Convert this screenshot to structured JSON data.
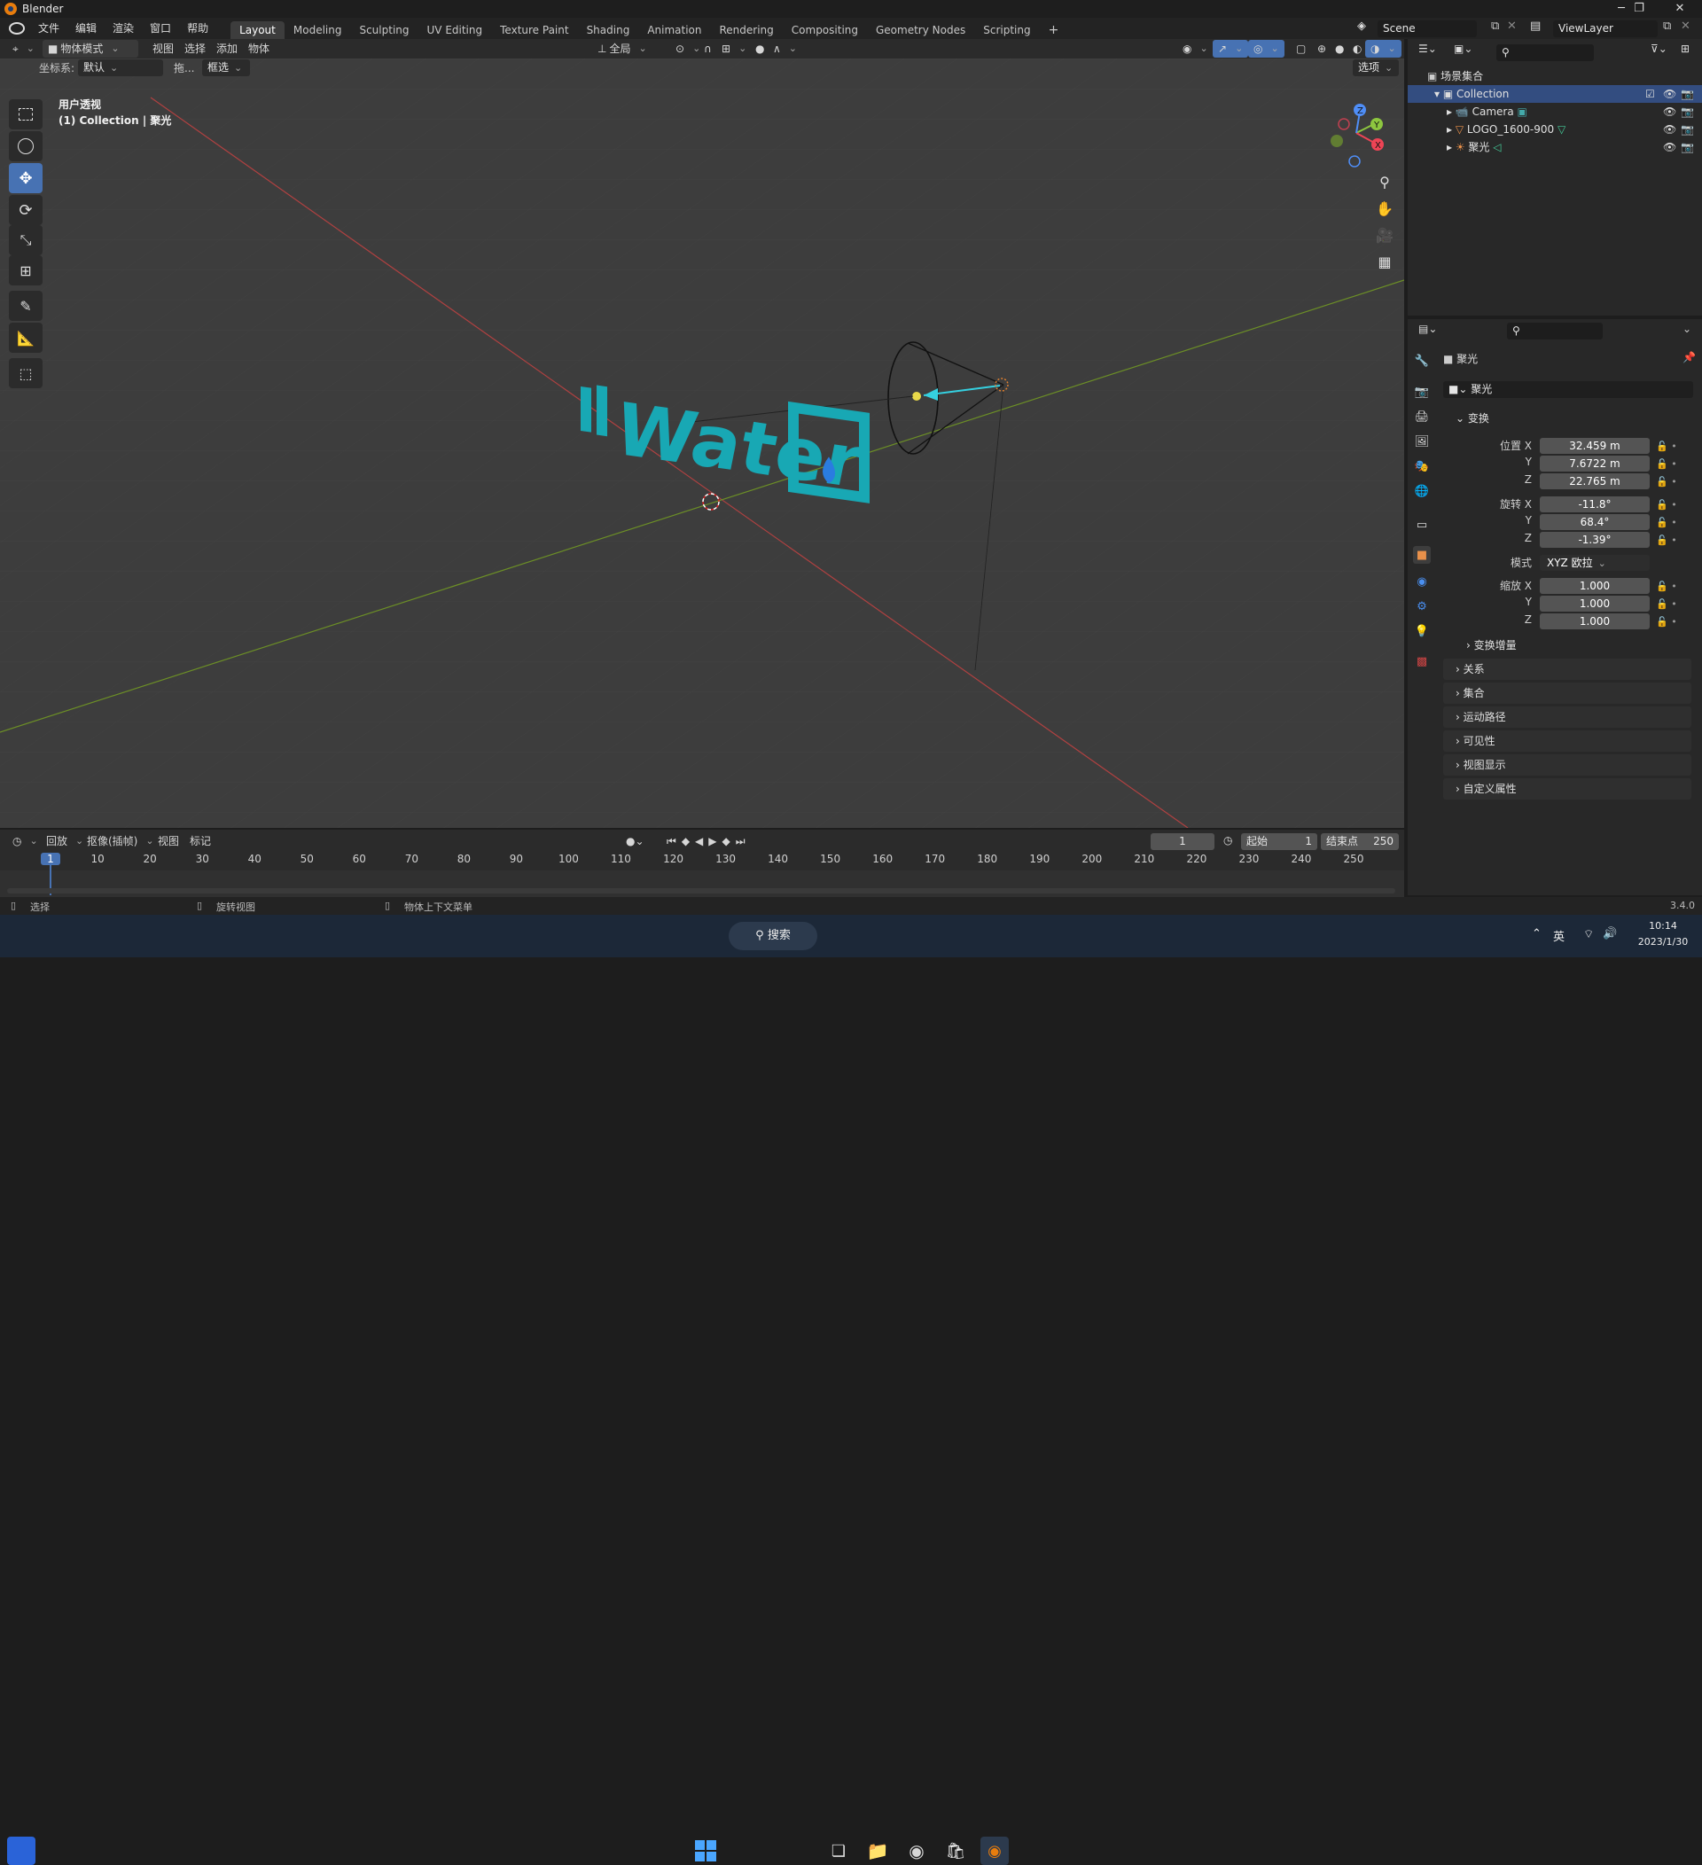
{
  "window": {
    "title": "Blender",
    "min": "─",
    "max": "❐",
    "close": "✕"
  },
  "menu": [
    "文件",
    "编辑",
    "渲染",
    "窗口",
    "帮助"
  ],
  "workspaces": [
    {
      "label": "Layout",
      "active": true
    },
    {
      "label": "Modeling"
    },
    {
      "label": "Sculpting"
    },
    {
      "label": "UV Editing"
    },
    {
      "label": "Texture Paint"
    },
    {
      "label": "Shading"
    },
    {
      "label": "Animation"
    },
    {
      "label": "Rendering"
    },
    {
      "label": "Compositing"
    },
    {
      "label": "Geometry Nodes"
    },
    {
      "label": "Scripting"
    }
  ],
  "add_workspace": "+",
  "scene": {
    "name": "Scene",
    "view_layer": "ViewLayer"
  },
  "viewport_header": {
    "mode": "物体模式",
    "menus": [
      "视图",
      "选择",
      "添加",
      "物体"
    ],
    "pivot": "全局"
  },
  "viewport_header2": {
    "coord_label": "坐标系:",
    "coord_value": "默认",
    "drag_label": "拖...",
    "select_mode": "框选",
    "options": "选项"
  },
  "viewport": {
    "view_name": "用户透视",
    "collection_info": "(1) Collection | 聚光",
    "logo_text": "Water"
  },
  "gizmo": {
    "x": "X",
    "y": "Y",
    "z": "Z"
  },
  "outliner": {
    "root": "场景集合",
    "collection": "Collection",
    "items": [
      {
        "name": "Camera",
        "icon": "camera-icon"
      },
      {
        "name": "LOGO_1600-900",
        "icon": "mesh-icon"
      },
      {
        "name": "聚光",
        "icon": "light-icon"
      }
    ]
  },
  "properties": {
    "object_name": "聚光",
    "data_name": "聚光",
    "transform_title": "变换",
    "location_label": "位置 X",
    "rotation_label": "旋转 X",
    "scale_label": "缩放 X",
    "y_label": "Y",
    "z_label": "Z",
    "mode_label": "模式",
    "location": [
      "32.459 m",
      "7.6722 m",
      "22.765 m"
    ],
    "rotation": [
      "-11.8°",
      "68.4°",
      "-1.39°"
    ],
    "rotation_mode": "XYZ 欧拉",
    "scale": [
      "1.000",
      "1.000",
      "1.000"
    ],
    "delta_transform": "变换增量",
    "panels": [
      "关系",
      "集合",
      "运动路径",
      "可见性",
      "视图显示",
      "自定义属性"
    ]
  },
  "timeline": {
    "menus": [
      "回放",
      "抠像(插帧)",
      "视图",
      "标记"
    ],
    "current_frame": "1",
    "start_label": "起始",
    "start": "1",
    "end_label": "结束点",
    "end": "250",
    "ticks": [
      "1",
      "10",
      "20",
      "30",
      "40",
      "50",
      "60",
      "70",
      "80",
      "90",
      "100",
      "110",
      "120",
      "130",
      "140",
      "150",
      "160",
      "170",
      "180",
      "190",
      "200",
      "210",
      "220",
      "230",
      "240",
      "250"
    ]
  },
  "statusbar": {
    "select": "选择",
    "rotate": "旋转视图",
    "context_menu": "物体上下文菜单",
    "version": "3.4.0"
  },
  "taskbar": {
    "search": "搜索",
    "ime": "英",
    "time": "10:14",
    "date": "2023/1/30"
  },
  "colors": {
    "accent": "#4772b3",
    "x_axis": "#c74848",
    "y_axis": "#7ba12e",
    "logo": "#18a8b4"
  }
}
